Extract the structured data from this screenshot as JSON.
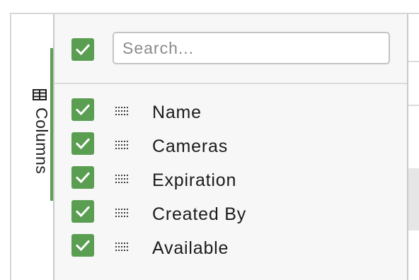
{
  "side_tab": {
    "label": "Columns",
    "icon": "columns-icon"
  },
  "panel": {
    "select_all_checked": true,
    "search": {
      "placeholder": "Search...",
      "value": ""
    }
  },
  "columns": [
    {
      "label": "Name",
      "checked": true
    },
    {
      "label": "Cameras",
      "checked": true
    },
    {
      "label": "Expiration",
      "checked": true
    },
    {
      "label": "Created By",
      "checked": true
    },
    {
      "label": "Available",
      "checked": true
    }
  ],
  "colors": {
    "accent": "#5a9e52",
    "panel_bg": "#f7f7f7",
    "border": "#c9c9c9"
  }
}
